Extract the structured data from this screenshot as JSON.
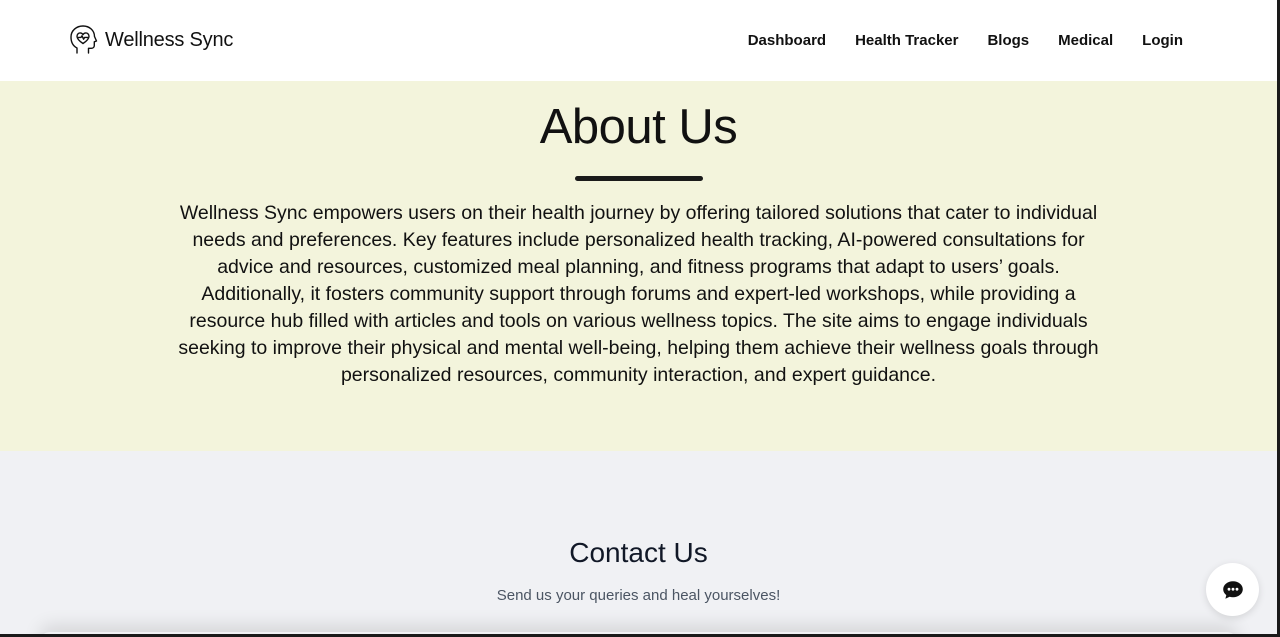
{
  "header": {
    "brand_name": "Wellness Sync",
    "brand_icon": "head-heart-icon",
    "nav": [
      {
        "label": "Dashboard"
      },
      {
        "label": "Health Tracker"
      },
      {
        "label": "Blogs"
      },
      {
        "label": "Medical"
      },
      {
        "label": "Login"
      }
    ]
  },
  "about": {
    "title": "About Us",
    "text": "Wellness Sync empowers users on their health journey by offering tailored solutions that cater to individual needs and preferences. Key features include personalized health tracking, AI-powered consultations for advice and resources, customized meal planning, and fitness programs that adapt to users’ goals. Additionally, it fosters community support through forums and expert-led workshops, while providing a resource hub filled with articles and tools on various wellness topics. The site aims to engage individuals seeking to improve their physical and mental well-being, helping them achieve their wellness goals through personalized resources, community interaction, and expert guidance."
  },
  "contact": {
    "title": "Contact Us",
    "subtitle": "Send us your queries and heal yourselves!"
  },
  "chat_button": {
    "icon": "chat-bubble-icon"
  },
  "colors": {
    "about_bg": "#f3f4dc",
    "contact_bg": "#f0f1f4",
    "text": "#111111"
  }
}
